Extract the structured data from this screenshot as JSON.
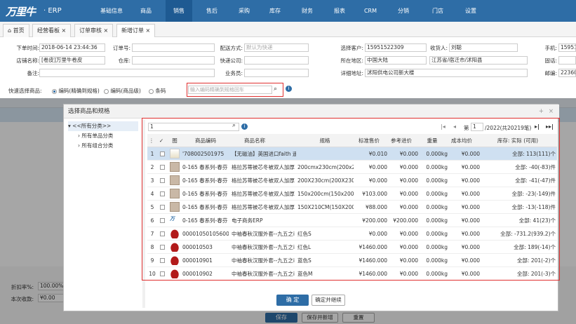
{
  "app": {
    "logo": "万里牛",
    "logo_suffix": "· ERP"
  },
  "menu": [
    "基础信息",
    "商品",
    "销售",
    "售后",
    "采购",
    "库存",
    "财务",
    "报表",
    "CRM",
    "分销",
    "门店",
    "设置"
  ],
  "menu_active": "销售",
  "tabs": [
    "首页",
    "经营看板",
    "订单审核",
    "新增订单"
  ],
  "form": {
    "order_time_label": "下单时间:",
    "order_time": "2018-06-14 23:44:36",
    "shop_label": "店铺名称:",
    "shop": "[卷皮]万里牛卷皮",
    "remark_label": "备注:",
    "order_no_label": "订单号:",
    "warehouse_label": "仓库:",
    "delivery_label": "配送方式:",
    "delivery_placeholder": "默认为快递",
    "express_label": "快递公司:",
    "salesman_label": "业务员:",
    "customer_label": "选择客户:",
    "customer": "15951522309",
    "receiver_label": "收货人:",
    "receiver": "刘聪",
    "phone_label": "手机:",
    "phone": "15951",
    "region_label": "所在地区:",
    "country": "中国大陆",
    "province": "江苏省/宿迁市/沭阳县",
    "tel_label": "固话:",
    "address_label": "详细地址:",
    "address": "沭阳供电公司新大楼",
    "zip_label": "邮编:",
    "zip": "22360"
  },
  "quick": {
    "label": "快速选择商品:",
    "opt1": "编码(精确到规格)",
    "opt2": "编码(商品级)",
    "opt3": "条码",
    "placeholder": "输入编码精确到规格回车"
  },
  "bottom": {
    "discount_label": "折扣率%:",
    "discount": "100.00%",
    "receive_label": "本次收款:",
    "receive": "¥0.00",
    "save": "保存",
    "save_new": "保存并新增",
    "reset": "重置"
  },
  "dialog": {
    "title": "选择商品和规格",
    "tree": [
      "<<所有分类>>",
      "所有单品分类",
      "所有组合分类"
    ],
    "search_value": "1",
    "page_label": "第",
    "page": "1",
    "page_total": "/2022(共20219笔)",
    "headers": [
      "图",
      "商品编码",
      "商品名称",
      "规格",
      "标准售价",
      "参考进价",
      "重量",
      "成本均价",
      "库存: 实际 (可用)"
    ],
    "rows": [
      {
        "n": "1",
        "code": "'708002501975",
        "name": "【无磁油】英国进口faith 遥",
        "spec": "",
        "price": "¥0.010",
        "cost": "¥0.000",
        "weight": "0.000kg",
        "avg": "¥0.000",
        "stock": "全部: 113(111)个",
        "thumb": "bottle",
        "sel": true
      },
      {
        "n": "2",
        "code": "0-165 春系列-春芬",
        "name": "格拉苏蒂被芯冬被双人加厚",
        "spec": "200cmx230cm(200x2",
        "price": "¥0.000",
        "cost": "¥0.000",
        "weight": "0.000kg",
        "avg": "¥0.000",
        "stock": "全部: -40(-83)件",
        "thumb": "quilt"
      },
      {
        "n": "3",
        "code": "0-165 春系列-春芬",
        "name": "格拉苏蒂被芯冬被双人加厚",
        "spec": "200X230cm(200X230",
        "price": "¥0.000",
        "cost": "¥0.000",
        "weight": "0.000kg",
        "avg": "¥0.000",
        "stock": "全部: -41(-47)件",
        "thumb": "quilt"
      },
      {
        "n": "4",
        "code": "0-165 春系列-春芬",
        "name": "格拉苏蒂被芯冬被双人加厚",
        "spec": "150x200cm(150x200",
        "price": "¥103.000",
        "cost": "¥0.000",
        "weight": "0.000kg",
        "avg": "¥0.000",
        "stock": "全部: -23(-149)件",
        "thumb": "quilt"
      },
      {
        "n": "5",
        "code": "0-165 春系列-春芬",
        "name": "格拉苏蒂被芯冬被双人加厚",
        "spec": "150X210CM(150X200",
        "price": "¥88.000",
        "cost": "¥0.000",
        "weight": "0.000kg",
        "avg": "¥0.000",
        "stock": "全部: -13(-118)件",
        "thumb": "quilt"
      },
      {
        "n": "6",
        "code": "0-165 春系列-春芬",
        "name": "电子商务ERP",
        "spec": "",
        "price": "¥200.000",
        "cost": "¥200.000",
        "weight": "0.000kg",
        "avg": "¥0.000",
        "stock": "全部: 41(23)个",
        "thumb": "logo"
      },
      {
        "n": "7",
        "code": "00001050105600(",
        "name": "中袖春秋汉服外套--九五之i",
        "spec": "红色S",
        "price": "¥0.000",
        "cost": "¥0.000",
        "weight": "0.000kg",
        "avg": "¥0.000",
        "stock": "全部: -731.2(939.2)个",
        "thumb": "red"
      },
      {
        "n": "8",
        "code": "000010503",
        "name": "中袖春秋汉服外套--九五之i",
        "spec": "红色L",
        "price": "¥1460.000",
        "cost": "¥0.000",
        "weight": "0.000kg",
        "avg": "¥0.000",
        "stock": "全部: 189(-14)个",
        "thumb": "red"
      },
      {
        "n": "9",
        "code": "000010901",
        "name": "中袖春秋汉服外套--九五之i",
        "spec": "蓝色S",
        "price": "¥1460.000",
        "cost": "¥0.000",
        "weight": "0.000kg",
        "avg": "¥0.000",
        "stock": "全部: 201(-2)个",
        "thumb": "red"
      },
      {
        "n": "10",
        "code": "000010902",
        "name": "中袖春秋汉服外套--九五之i",
        "spec": "蓝色M",
        "price": "¥1460.000",
        "cost": "¥0.000",
        "weight": "0.000kg",
        "avg": "¥0.000",
        "stock": "全部: 201(-3)个",
        "thumb": "red"
      }
    ],
    "confirm": "确 定",
    "confirm_continue": "确定并继续"
  },
  "colors": {
    "primary": "#2e6da6",
    "highlight": "#e03030"
  }
}
